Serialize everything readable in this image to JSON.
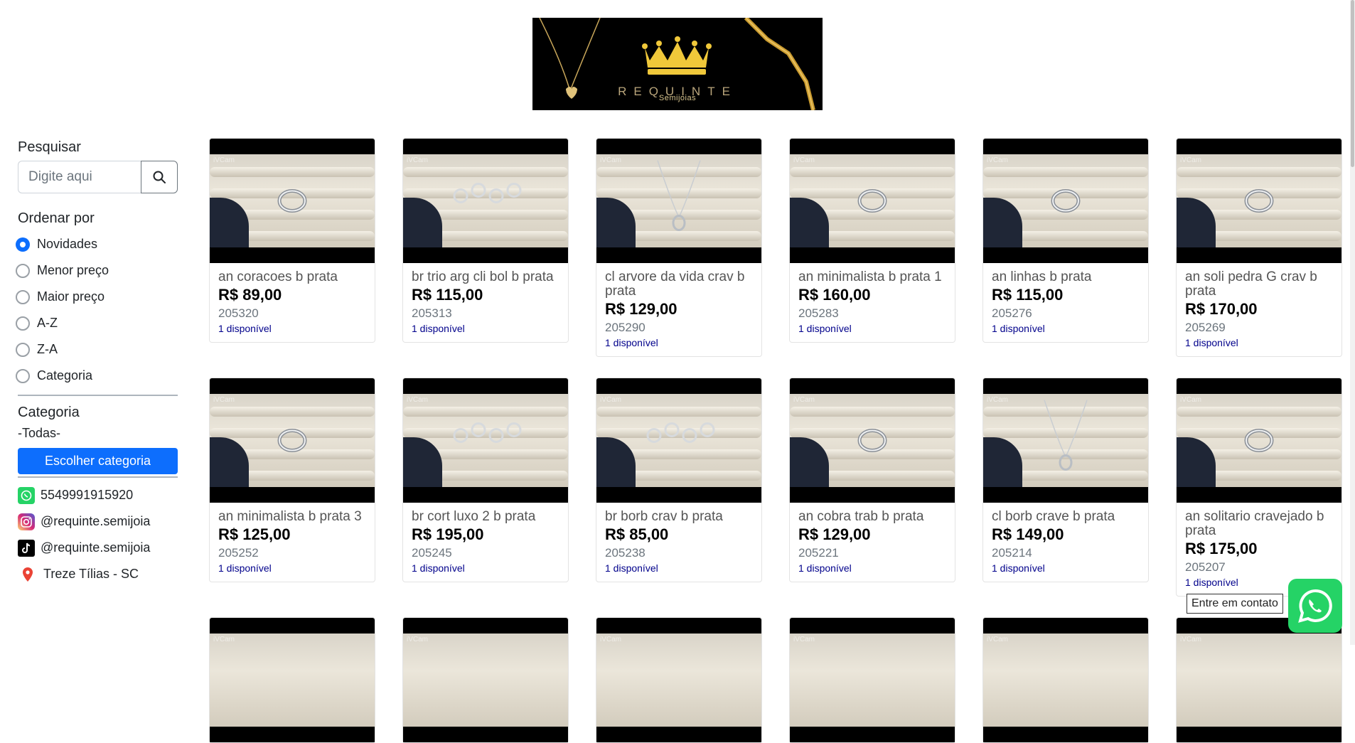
{
  "brand": {
    "name": "REQUINTE",
    "subtitle": "Semijoias"
  },
  "sidebar": {
    "search_title": "Pesquisar",
    "search_placeholder": "Digite aqui",
    "order_title": "Ordenar por",
    "order_options": [
      {
        "label": "Novidades",
        "checked": true
      },
      {
        "label": "Menor preço",
        "checked": false
      },
      {
        "label": "Maior preço",
        "checked": false
      },
      {
        "label": "A-Z",
        "checked": false
      },
      {
        "label": "Z-A",
        "checked": false
      },
      {
        "label": "Categoria",
        "checked": false
      }
    ],
    "category_title": "Categoria",
    "category_current": "-Todas-",
    "category_button": "Escolher categoria",
    "contacts": [
      {
        "icon": "whatsapp-icon",
        "text": "5549991915920"
      },
      {
        "icon": "instagram-icon",
        "text": "@requinte.semijoia"
      },
      {
        "icon": "tiktok-icon",
        "text": "@requinte.semijoia"
      },
      {
        "icon": "location-pin-icon",
        "text": "Treze Tílias - SC"
      }
    ]
  },
  "products": [
    {
      "name": "an coracoes b prata",
      "price": "R$ 89,00",
      "code": "205320",
      "stock": "1 disponível",
      "jewel": "ring"
    },
    {
      "name": "br trio arg cli bol b prata",
      "price": "R$ 115,00",
      "code": "205313",
      "stock": "1 disponível",
      "jewel": "earrings"
    },
    {
      "name": "cl arvore da vida crav b prata",
      "price": "R$ 129,00",
      "code": "205290",
      "stock": "1 disponível",
      "jewel": "necklace"
    },
    {
      "name": "an minimalista b prata 1",
      "price": "R$ 160,00",
      "code": "205283",
      "stock": "1 disponível",
      "jewel": "ring"
    },
    {
      "name": "an linhas b prata",
      "price": "R$ 115,00",
      "code": "205276",
      "stock": "1 disponível",
      "jewel": "ring"
    },
    {
      "name": "an soli pedra G crav b prata",
      "price": "R$ 170,00",
      "code": "205269",
      "stock": "1 disponível",
      "jewel": "ring"
    },
    {
      "name": "an minimalista b prata 3",
      "price": "R$ 125,00",
      "code": "205252",
      "stock": "1 disponível",
      "jewel": "ring"
    },
    {
      "name": "br cort luxo 2 b prata",
      "price": "R$ 195,00",
      "code": "205245",
      "stock": "1 disponível",
      "jewel": "earrings"
    },
    {
      "name": "br borb crav b prata",
      "price": "R$ 85,00",
      "code": "205238",
      "stock": "1 disponível",
      "jewel": "earrings"
    },
    {
      "name": "an cobra trab b prata",
      "price": "R$ 129,00",
      "code": "205221",
      "stock": "1 disponível",
      "jewel": "ring"
    },
    {
      "name": "cl borb crave b prata",
      "price": "R$ 149,00",
      "code": "205214",
      "stock": "1 disponível",
      "jewel": "necklace"
    },
    {
      "name": "an solitario cravejado b prata",
      "price": "R$ 175,00",
      "code": "205207",
      "stock": "1 disponível",
      "jewel": "ring"
    }
  ],
  "image_watermark": "iVCam",
  "whatsapp_float": {
    "tooltip": "Entre em contato"
  },
  "colors": {
    "primary": "#0d6efd",
    "stock": "#00008b",
    "whatsapp": "#25d366"
  }
}
